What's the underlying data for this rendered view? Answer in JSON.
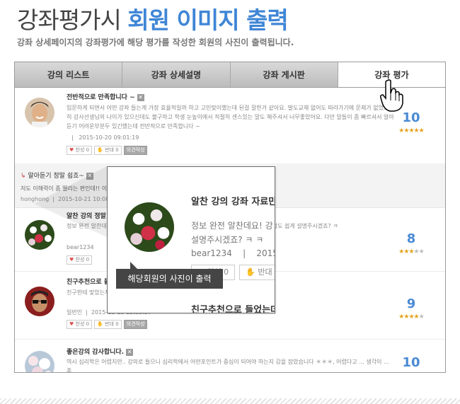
{
  "heading": {
    "title_plain": "강좌평가시 ",
    "title_highlight": "회원 이미지 출력"
  },
  "subtitle": "강좌 상세페이지의 강좌평가에 해당 평가를 작성한 회원의 사진이 출력됩니다.",
  "tabs": [
    "강의 리스트",
    "강좌 상세설명",
    "강좌 게시판",
    "강좌 평가"
  ],
  "active_tab": "강좌 평가",
  "colors": {
    "accent": "#3f86d6",
    "score": "#4a8ad4",
    "star": "#e5a21d",
    "tooltip_bg": "#454545"
  },
  "reviews": [
    {
      "title": "전반적으로 만족합니다 ~",
      "body": "입문하게 되면서 어떤 강좌 들는게 가장 효율적일까 하고 고민맞이했는데 된걸 잘한거 같아요. 발도교재 없어도 따라가기에 문제가 없었고 특히 강사선생님의 나이가 있으신데도 불구하고 학생 눈높이에서 적절히 센스있는 말도 해주셔서 너무좋았어요. 다만 말들이 좀 빠르셔서 알아듣기 어려운부분두 있긴했는데 전반적으로 만족합니다 ~",
      "author": "",
      "date": "2015-10-20 09:01:19",
      "like_label": "찬성",
      "like_count": "0",
      "dislike_label": "반대",
      "dislike_count": "0",
      "opinion_label": "의견작성",
      "score": "10",
      "rating": 5,
      "photo": "man-portrait"
    },
    {
      "title": "알찬 강의 정말 강좌 ...",
      "body": "정보 완전 알찬데요! 잘 알아듣게 설명주시겠죠? ㅋ ㅋ 보 알기쉬웠던거 같아요. 다음 과정도 쉽게 설명주시겠죠? ㅋ",
      "author": "bear1234",
      "date": "",
      "like_label": "찬성",
      "like_count": "0",
      "dislike_label": "반대",
      "dislike_count": "",
      "opinion_label": "",
      "score": "8",
      "rating": 3,
      "photo": "flowers"
    },
    {
      "title": "친구추천으로 들었...",
      "body": "친구한테 맞았는지 ... 다른 친구들한테도 널리널리 알려줘야겠어요 ^^ 맞았는지 ...",
      "author": "일반인",
      "date": "2015-10-19 15:39:57",
      "like_label": "찬성",
      "like_count": "0",
      "dislike_label": "반대",
      "dislike_count": "0",
      "opinion_label": "의견작성",
      "score": "9",
      "rating": 4,
      "photo": "man-sunglasses"
    },
    {
      "title": "좋은강의 감사합니다.",
      "body": "역시 심리학은 어렵지만.. 강의로 들으니 심리학에서 어떤포인트가 중심이 되어야 하는지 감을 잡았습니다 ＊＊＊, 어렵다고 ... 생각이 ... 좀 ...",
      "author": "",
      "date": "",
      "like_label": "",
      "like_count": "",
      "dislike_label": "",
      "dislike_count": "",
      "opinion_label": "",
      "score": "10",
      "rating": 5,
      "photo": "cherry-blossom"
    }
  ],
  "reply": {
    "title": "알아듣기 정말 쉽죠~",
    "body": "저도 이해력이 좀 떨리는 편인데!! 이 강좌...",
    "author": "honghong",
    "date": "2015-10-21 10:08:41"
  },
  "popup": {
    "title": "알찬 강의 강좌 자료만",
    "body_line1": "정보 완전 알찬데요! 강",
    "body_line2": "설명주시겠죠? ㅋ ㅋ",
    "author": "bear1234",
    "separator": "|",
    "date": "2015-1",
    "like_label": "찬성",
    "like_count": "0",
    "dislike_label": "반대",
    "dislike_count": "0",
    "title2": "친구추천으로 들었는데"
  },
  "tooltip": "해당회원의 사진이 출력"
}
